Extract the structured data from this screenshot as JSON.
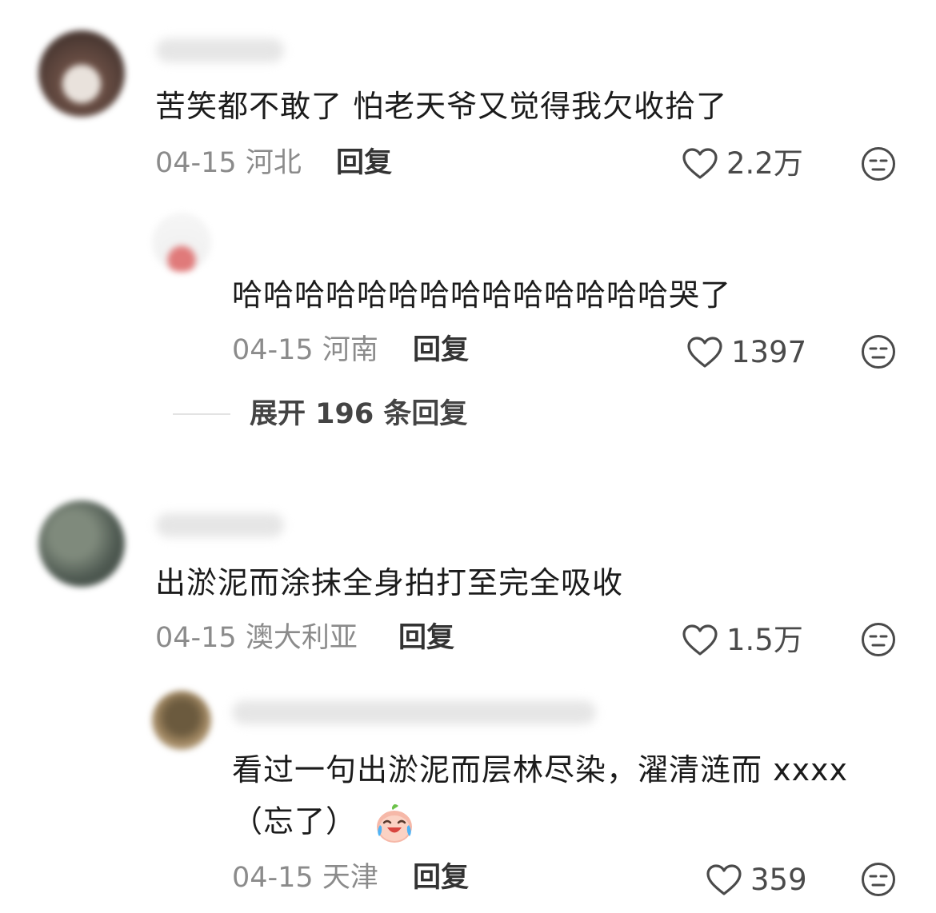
{
  "comments": [
    {
      "text": "苦笑都不敢了 怕老天爷又觉得我欠收拾了",
      "date": "04-15",
      "location": "河北",
      "reply_label": "回复",
      "likes": "2.2万",
      "replies": [
        {
          "text": "哈哈哈哈哈哈哈哈哈哈哈哈哈哈哭了",
          "date": "04-15",
          "location": "河南",
          "reply_label": "回复",
          "likes": "1397"
        }
      ],
      "expand_label": "展开 196 条回复"
    },
    {
      "text": "出淤泥而涂抹全身拍打至完全吸收",
      "date": "04-15",
      "location": "澳大利亚",
      "reply_label": "回复",
      "likes": "1.5万",
      "replies": [
        {
          "text_line1": "看过一句出淤泥而层林尽染，濯清涟而 xxxx",
          "text_line2": "（忘了）",
          "date": "04-15",
          "location": "天津",
          "reply_label": "回复",
          "likes": "359"
        }
      ]
    }
  ],
  "icons": {
    "like": "heart-outline-icon",
    "dislike": "neutral-face-icon",
    "emoji": "crying-laughing-peach-emoji"
  },
  "colors": {
    "meta": "#8b8b8b",
    "text": "#1b1b1b"
  }
}
